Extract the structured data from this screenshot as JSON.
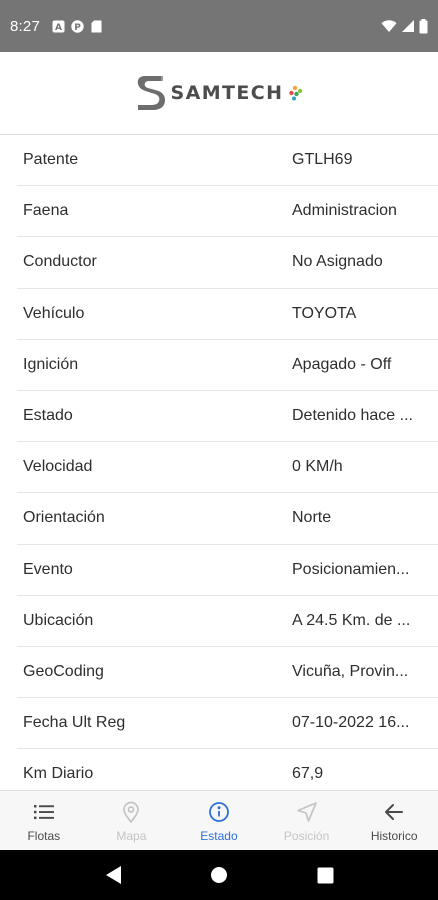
{
  "status_bar": {
    "time": "8:27",
    "notifications": [
      "a-icon",
      "p-icon",
      "sd-card-icon"
    ],
    "indicators": [
      "wifi-icon",
      "signal-icon",
      "battery-icon"
    ]
  },
  "header": {
    "logo_text": "SAMTECH"
  },
  "info_rows": [
    {
      "label": "Patente",
      "value": "GTLH69"
    },
    {
      "label": "Faena",
      "value": "Administracion"
    },
    {
      "label": "Conductor",
      "value": "No Asignado"
    },
    {
      "label": "Vehículo",
      "value": "TOYOTA"
    },
    {
      "label": "Ignición",
      "value": "Apagado - Off"
    },
    {
      "label": "Estado",
      "value": "Detenido hace ..."
    },
    {
      "label": "Velocidad",
      "value": "0 KM/h"
    },
    {
      "label": "Orientación",
      "value": "Norte"
    },
    {
      "label": "Evento",
      "value": "Posicionamien..."
    },
    {
      "label": "Ubicación",
      "value": "A 24.5 Km. de ..."
    },
    {
      "label": "GeoCoding",
      "value": "Vicuña, Provin..."
    },
    {
      "label": "Fecha Ult Reg",
      "value": "07-10-2022 16..."
    },
    {
      "label": "Km Diario",
      "value": "67,9"
    }
  ],
  "bottom_nav": [
    {
      "label": "Flotas",
      "icon": "list-icon",
      "state": "normal"
    },
    {
      "label": "Mapa",
      "icon": "map-pin-icon",
      "state": "disabled"
    },
    {
      "label": "Estado",
      "icon": "info-icon",
      "state": "active"
    },
    {
      "label": "Posición",
      "icon": "navigation-arrow-icon",
      "state": "disabled"
    },
    {
      "label": "Historico",
      "icon": "back-arrow-icon",
      "state": "normal"
    }
  ],
  "system_nav": [
    "back-icon",
    "home-icon",
    "recents-icon"
  ],
  "colors": {
    "status_bar": "#757575",
    "active_tab": "#2f6fd6",
    "disabled_tab": "#c4c4c4",
    "normal_tab": "#4a4a4a"
  }
}
